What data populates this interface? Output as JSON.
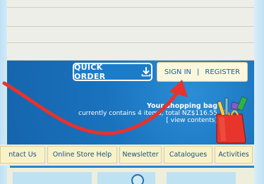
{
  "header": {
    "quick_order_label": "QUICK ORDER",
    "sign_in_label": "SIGN IN",
    "separator": "|",
    "register_label": "REGISTER"
  },
  "bag": {
    "title": "Your shopping bag",
    "summary": "currently contains 4 items, total NZ$116.55",
    "view_link": "[ view contents]"
  },
  "nav": {
    "items": [
      {
        "label": "ntact Us"
      },
      {
        "label": "Online Store Help"
      },
      {
        "label": "Newsletter"
      },
      {
        "label": "Catalogues"
      },
      {
        "label": "Activities"
      }
    ]
  },
  "colors": {
    "annotation_arrow": "#e8322b",
    "banner": "#1a72bd",
    "nav_tab": "#f8f2c6"
  },
  "icons": [
    "download-arrow-icon",
    "shopping-bag-icon"
  ]
}
